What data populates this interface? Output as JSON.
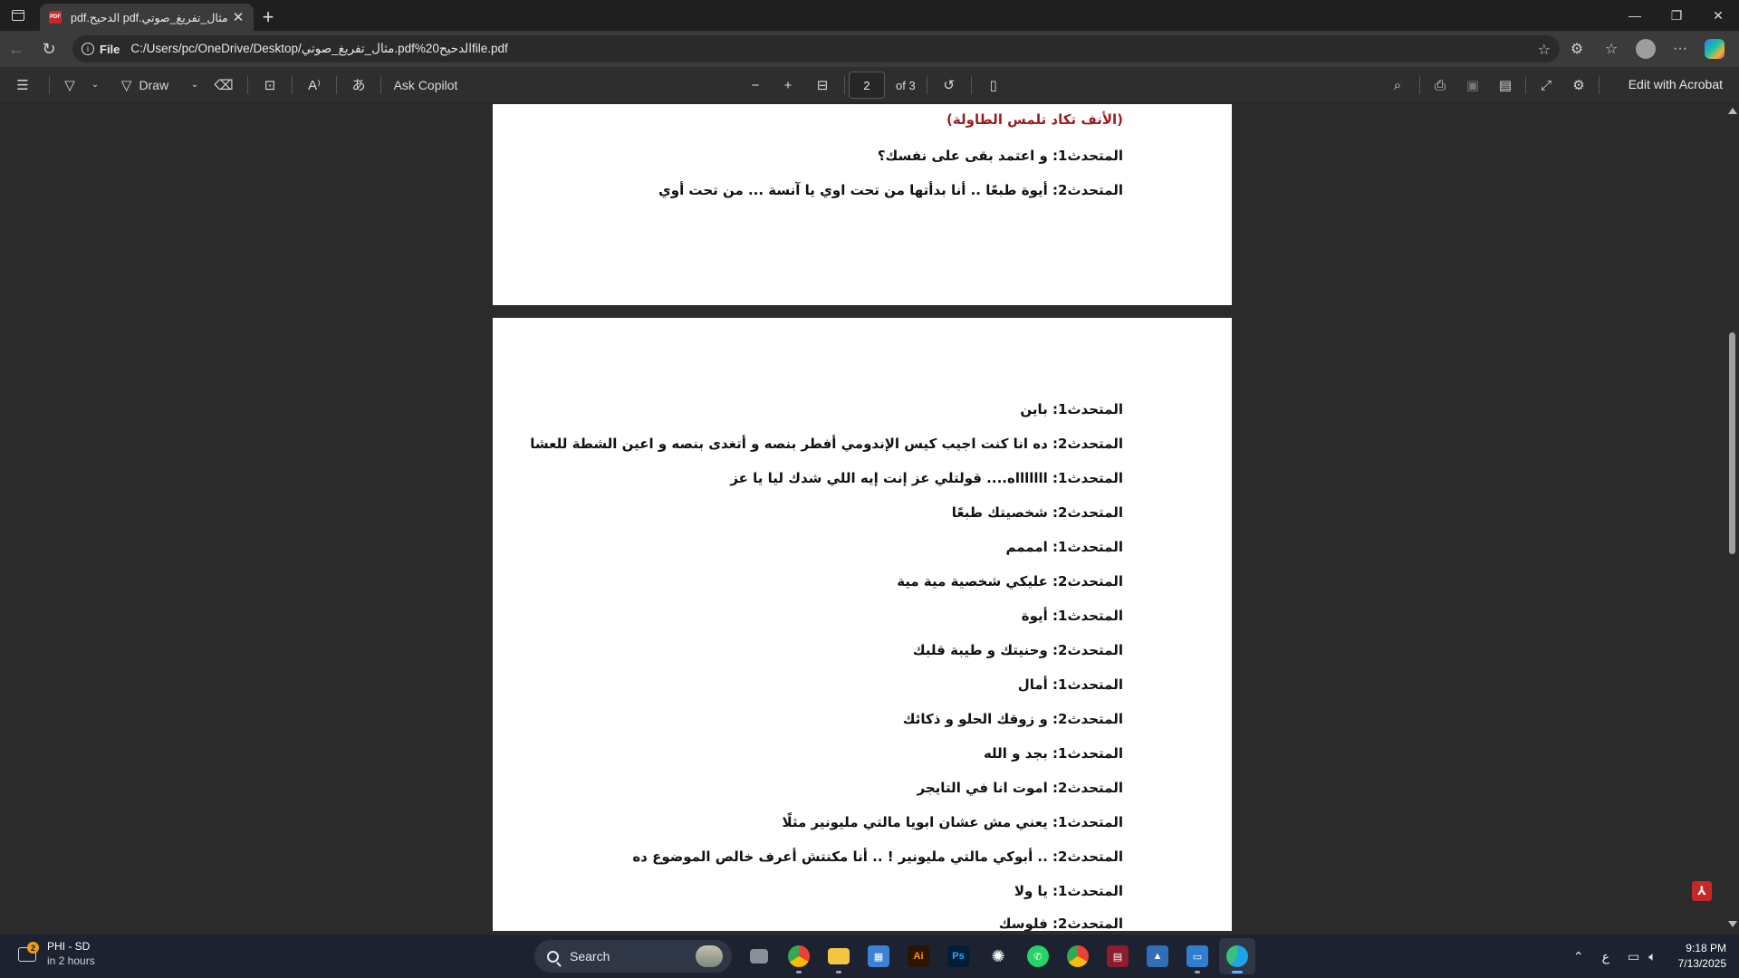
{
  "browser": {
    "tab_title": "مثال_تفريغ_صوتي.pdf الدحيح.pdf",
    "url_scheme": "File",
    "url_path": "C:/Users/pc/OneDrive/Desktop/مثال_تفريغ_صوتي.pdf%20الدحيحfile.pdf"
  },
  "pdf_toolbar": {
    "draw_label": "Draw",
    "ask_copilot_label": "Ask Copilot",
    "page_number": "2",
    "page_total": "of 3",
    "edit_acrobat_label": "Edit with Acrobat"
  },
  "document": {
    "page1_lines": [
      {
        "text": "(الأنف تكاد تلمس الطاولة)",
        "red": true
      },
      {
        "text": "المتحدث1: و اعتمد بقى على نفسك؟",
        "red": false
      },
      {
        "text": "المتحدث2: أيوة طبعًا .. أنا بدأتها من تحت اوي يا آنسة ... من تحت أوي",
        "red": false
      }
    ],
    "page2_lines": [
      "المتحدث1: باين",
      "المتحدث2: ده انا كنت اجيب كيس الإندومي أفطر بنصه و أتغدى بنصه و اعين الشطة للعشا",
      "المتحدث1: اااااااه.... قولتلي عز إنت إيه اللي شدك ليا يا عز",
      "المتحدث2: شخصيتك طبعًا",
      "المتحدث1: امممم",
      "المتحدث2: عليكي شخصية مية مية",
      "المتحدث1: أيوة",
      "المتحدث2: وحنيتك و طيبة قلبك",
      "المتحدث1: أمال",
      "المتحدث2: و زوقك الحلو و ذكائك",
      "المتحدث1: بجد و الله",
      "المتحدث2: اموت انا في التايجر",
      "المتحدث1: يعني مش عشان ابويا مالتي مليونير مثلًا",
      "المتحدث2: .. أبوكي مالتي مليونير ! .. أنا مكنتش أعرف خالص الموضوع ده",
      "المتحدث1: يا ولا",
      "المتحدث2: فلوسك"
    ]
  },
  "taskbar": {
    "weather_badge": "2",
    "weather_title": "PHI - SD",
    "weather_sub": "in 2 hours",
    "search_label": "Search",
    "lang": "ع",
    "time": "9:18 PM",
    "date": "7/13/2025"
  },
  "colors": {
    "accent_red": "#9b1c1c",
    "taskbar_bg": "#1c2230"
  }
}
